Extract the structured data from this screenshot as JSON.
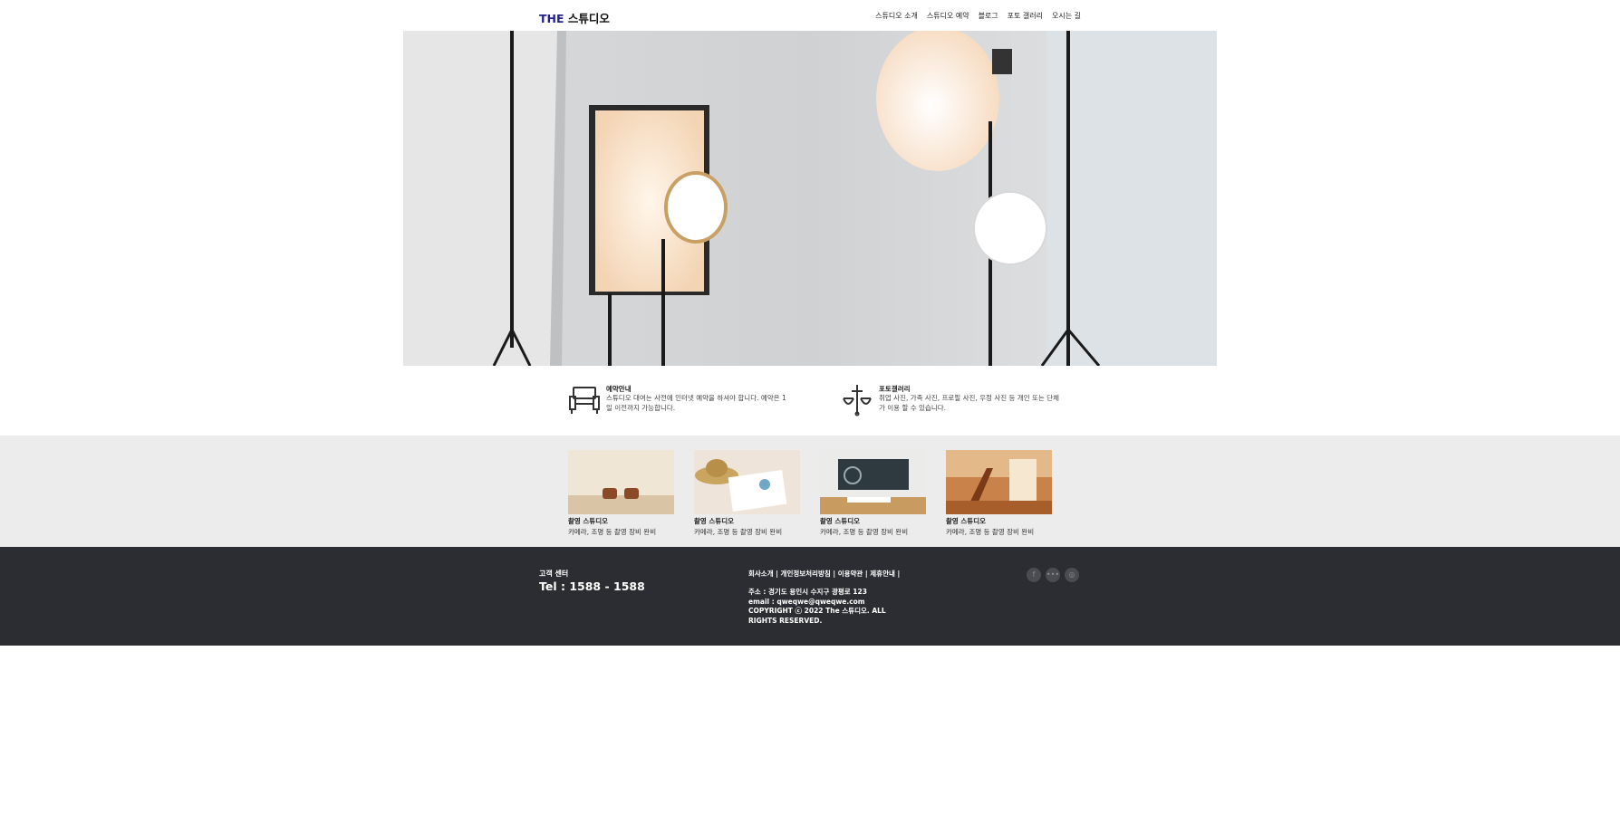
{
  "header": {
    "logo_brand": "THE",
    "logo_rest": " 스튜디오",
    "nav": [
      "스튜디오 소개",
      "스튜디오 예약",
      "블로그",
      "포토 갤러리",
      "오시는 길"
    ]
  },
  "info": [
    {
      "title": "예약안내",
      "desc": "스튜디오 대여는 사전에 인터넷 예약을 하셔야 합니다. 예약은 1일 이전까지 가능합니다.",
      "icon": "sofa-icon"
    },
    {
      "title": "포토갤러리",
      "desc": "취업 사진, 가족 사진, 프로필 사진, 우정 사진 등 개인 또는 단체가 이용 할 수 있습니다.",
      "icon": "chandelier-icon"
    }
  ],
  "gallery": [
    {
      "title": "촬영 스튜디오",
      "desc": "카메라, 조명 등 촬영 장비 완비"
    },
    {
      "title": "촬영 스튜디오",
      "desc": "카메라, 조명 등 촬영 장비 완비"
    },
    {
      "title": "촬영 스튜디오",
      "desc": "카메라, 조명 등 촬영 장비 완비"
    },
    {
      "title": "촬영 스튜디오",
      "desc": "카메라, 조명 등 촬영 장비 완비"
    }
  ],
  "footer": {
    "cs_title": "고객 센터",
    "tel": "Tel : 1588 - 1588",
    "links": "회사소개 | 개인정보처리방침 | 이용약관 | 제휴안내 |",
    "address": "주소 : 경기도 용인시 수지구 광평로 123",
    "email": "email : qweqwe@qweqwe.com",
    "copyright": "COPYRIGHT ⓒ 2022 The 스튜디오. ALL RIGHTS RESERVED.",
    "social": [
      "facebook-icon",
      "blog-icon",
      "instagram-icon"
    ]
  },
  "colors": {
    "brand": "#23218f",
    "footer_bg": "#2b2d32",
    "gallery_bg": "#ececec"
  }
}
